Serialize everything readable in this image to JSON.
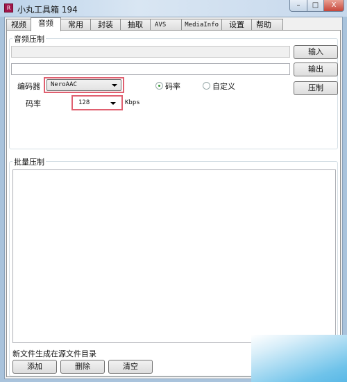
{
  "window": {
    "title": "小丸工具箱 194",
    "icon_text": "R",
    "minimize": "–",
    "maximize": "□",
    "close": "X"
  },
  "tabs": [
    {
      "label": "视频"
    },
    {
      "label": "音频",
      "active": true
    },
    {
      "label": "常用"
    },
    {
      "label": "封装"
    },
    {
      "label": "抽取"
    },
    {
      "label": "AVS"
    },
    {
      "label": "MediaInfo"
    },
    {
      "label": "设置"
    },
    {
      "label": "帮助"
    }
  ],
  "audio": {
    "group_label": "音频压制",
    "input_value": "",
    "output_value": "",
    "input_button": "输入",
    "output_button": "输出",
    "encoder_label": "编码器",
    "encoder_value": "NeroAAC",
    "mode_bitrate": "码率",
    "mode_custom": "自定义",
    "mode_selected": "码率",
    "encode_button": "压制",
    "bitrate_label": "码率",
    "bitrate_value": "128",
    "bitrate_unit": "Kbps"
  },
  "batch": {
    "group_label": "批量压制",
    "items": [],
    "note": "新文件生成在源文件目录",
    "add_button": "添加",
    "delete_button": "删除",
    "clear_button": "清空"
  },
  "colors": {
    "highlight_box": "#e06070",
    "app_icon": "#a0154b"
  }
}
